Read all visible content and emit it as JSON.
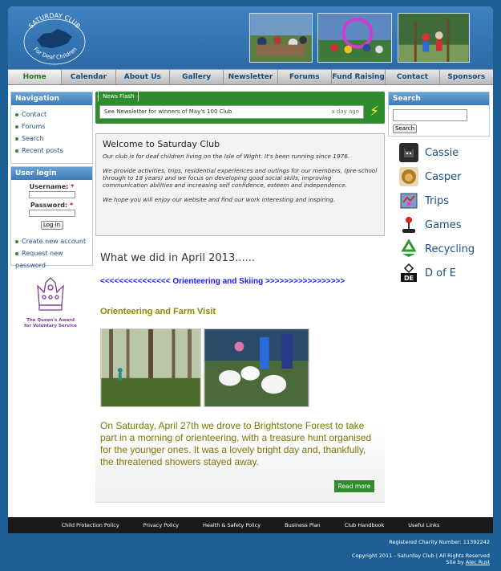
{
  "header": {
    "logo_top": "SATURDAY CLUB",
    "logo_bottom": "For Deaf Children"
  },
  "menu": [
    "Home",
    "Calendar",
    "About Us",
    "Gallery",
    "Newsletter",
    "Forums",
    "Fund Raising",
    "Contact",
    "Sponsors"
  ],
  "navigation": {
    "title": "Navigation",
    "items": [
      "Contact",
      "Forums",
      "Search",
      "Recent posts"
    ]
  },
  "login": {
    "title": "User login",
    "username_label": "Username:",
    "password_label": "Password:",
    "required": "*",
    "button": "Log in",
    "links": [
      "Create new account",
      "Request new password"
    ]
  },
  "award": {
    "line1": "The Queen's Award",
    "line2": "for Voluntary Service"
  },
  "newsflash": {
    "tab": "News Flash",
    "text": "See Newsletter for winners of May's 100 Club",
    "ago": "a day ago",
    "icon": "lightning-icon"
  },
  "welcome": {
    "title": "Welcome to Saturday Club",
    "p1": "Our club is for deaf children living on the Isle of Wight. It's been running since 1976.",
    "p2": "We provide activities, trips, residential experiences and outings for our members, (pre-school through to 18 years) and we focus on developing good social skills, improving communication abilities and increasing self confidence, esteem and independence.",
    "p3": "We hope you will enjoy our website and find our work interesting and inspiring."
  },
  "article": {
    "title": "What we did in April 2013......",
    "skiing_link": "<<<<<<<<<<<<<<< Orienteering and Skiing >>>>>>>>>>>>>>>>>",
    "subtitle": "Orienteering and Farm Visit",
    "body": "On Saturday, April 27th we drove to Brightstone Forest to take part in a morning of orienteering, with a treasure hunt organised for the younger ones. It was a lovely bright day and, thankfully, the threatened showers stayed away.",
    "read_more": "Read more"
  },
  "search": {
    "title": "Search",
    "button": "Search"
  },
  "sidebar_links": [
    {
      "label": "Cassie",
      "icon": "dog-icon"
    },
    {
      "label": "Casper",
      "icon": "lion-icon"
    },
    {
      "label": "Trips",
      "icon": "map-icon"
    },
    {
      "label": "Games",
      "icon": "joystick-icon"
    },
    {
      "label": "Recycling",
      "icon": "recycle-icon"
    },
    {
      "label": "D of E",
      "icon": "dofe-icon"
    }
  ],
  "footer": {
    "links": [
      "Child Protection Policy",
      "Privacy Policy",
      "Health & Safety Policy",
      "Business Plan",
      "Club Handbook",
      "Useful Links"
    ],
    "charity": "Registered Charity Number: 11392242",
    "copyright": "Copyright 2011 - Saturday Club | All Rights Reserved",
    "site_by": "Site by",
    "author": "Alec Rust"
  },
  "colors": {
    "page_bg": "#1d5f95",
    "accent_green": "#2e8b2e",
    "link_blue": "#1a4f85",
    "olive_text": "#7a7a00"
  }
}
